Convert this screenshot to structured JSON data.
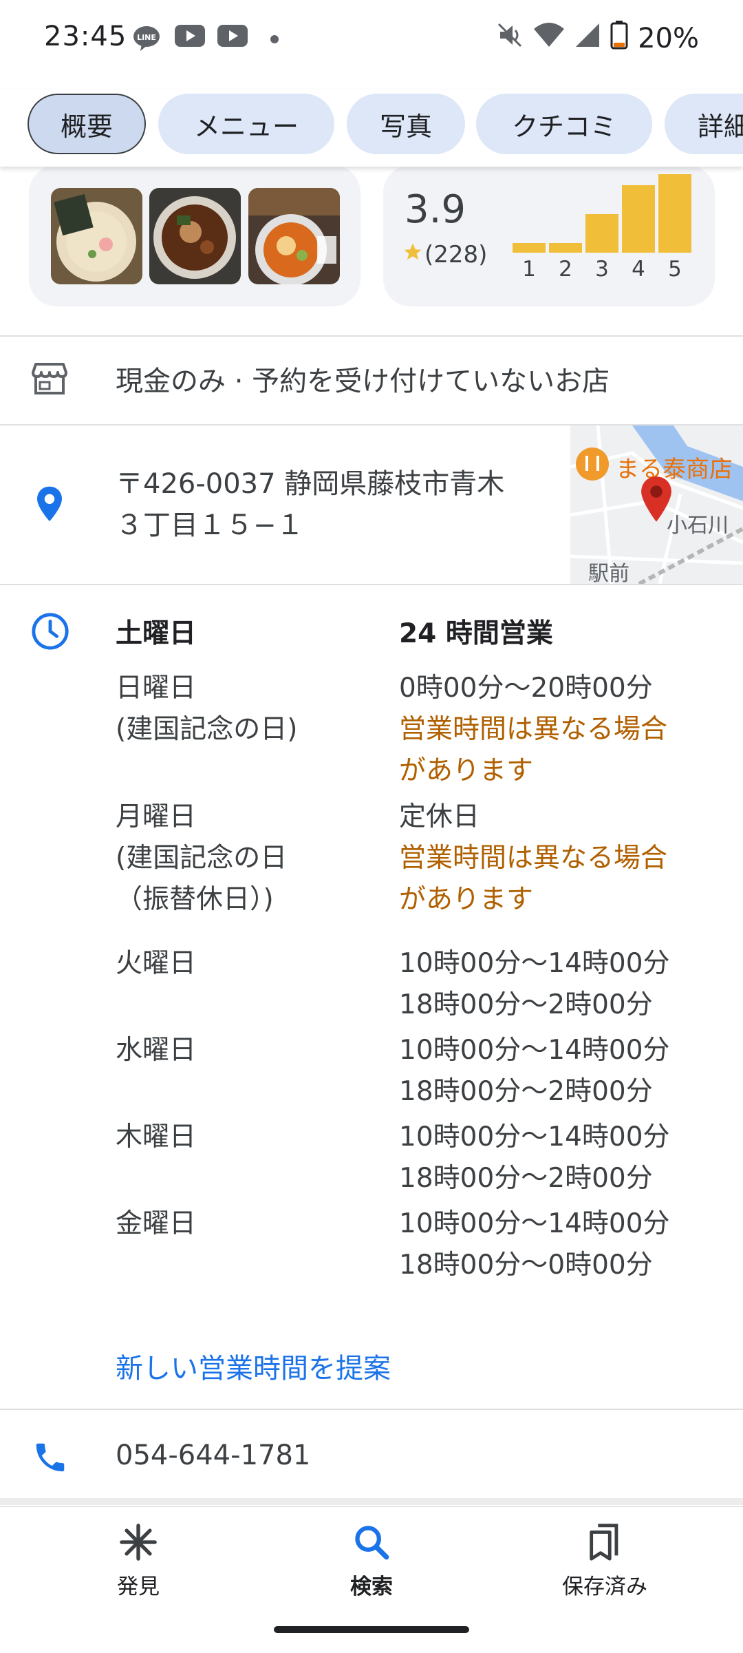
{
  "status_bar": {
    "time": "23:45",
    "battery": "20%",
    "icons": [
      "line-icon",
      "youtube-icon",
      "youtube-icon",
      "dot-icon",
      "mute-icon",
      "wifi-icon",
      "signal-icon",
      "battery-icon"
    ]
  },
  "tabs": [
    "概要",
    "メニュー",
    "写真",
    "クチコミ",
    "詳細"
  ],
  "rating": {
    "score": "3.9",
    "count": "(228)",
    "bars": [
      {
        "label": "1",
        "level": 0.12
      },
      {
        "label": "2",
        "level": 0.12
      },
      {
        "label": "3",
        "level": 0.47
      },
      {
        "label": "4",
        "level": 0.82
      },
      {
        "label": "5",
        "level": 0.95
      }
    ]
  },
  "service_options": "現金のみ · 予約を受け付けていないお店",
  "address": {
    "line1": "〒426-0037 静岡県藤枝市青木",
    "line2": "３丁目１５−１"
  },
  "map": {
    "poi_label": "まる泰商店",
    "place_label": "小石川",
    "station_label": "駅前"
  },
  "hours": {
    "days": [
      {
        "day": "土曜日",
        "hours": "24 時間営業"
      },
      {
        "day": "日曜日",
        "holiday": "(建国記念の日)",
        "hours": "0時00分～20時00分",
        "note_line1": "営業時間は異なる場合",
        "note_line2": "があります"
      },
      {
        "day": "月曜日",
        "holiday_line1": "(建国記念の日",
        "holiday_line2": "（振替休日）)",
        "hours": "定休日",
        "note_line1": "営業時間は異なる場合",
        "note_line2": "があります"
      },
      {
        "day": "火曜日",
        "hours_line1": "10時00分～14時00分",
        "hours_line2": "18時00分～2時00分"
      },
      {
        "day": "水曜日",
        "hours_line1": "10時00分～14時00分",
        "hours_line2": "18時00分～2時00分"
      },
      {
        "day": "木曜日",
        "hours_line1": "10時00分～14時00分",
        "hours_line2": "18時00分～2時00分"
      },
      {
        "day": "金曜日",
        "hours_line1": "10時00分～14時00分",
        "hours_line2": "18時00分～0時00分"
      }
    ],
    "suggest_link": "新しい営業時間を提案"
  },
  "phone": "054-644-1781",
  "bottom_nav": [
    "発見",
    "検索",
    "保存済み"
  ],
  "colors": {
    "accent": "#1a73e8",
    "star": "#f1be3a",
    "note": "#b06000",
    "pin": "#d93025"
  }
}
